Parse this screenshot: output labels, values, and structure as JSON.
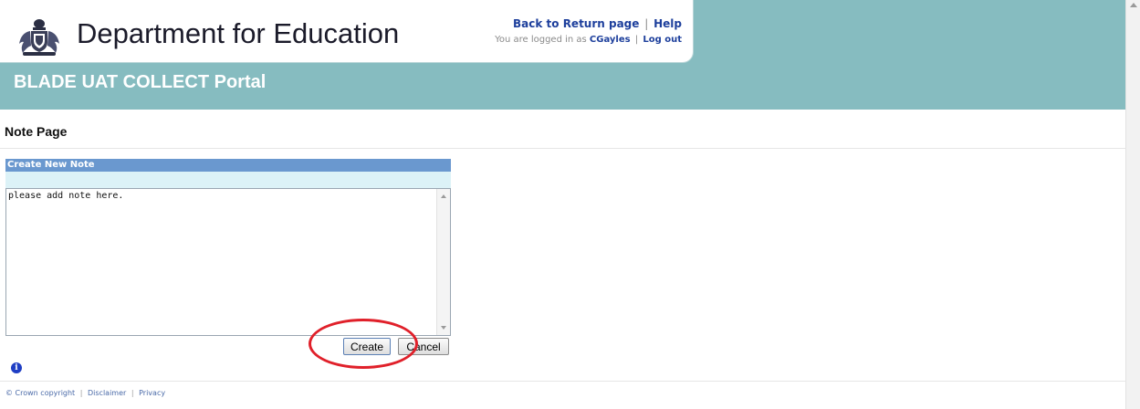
{
  "header": {
    "department": "Department for Education",
    "back_link": "Back to Return page",
    "separator": "|",
    "help_link": "Help",
    "logged_in_prefix": "You are logged in as",
    "username": "CGayles",
    "logout_link": "Log out",
    "portal_title": "BLADE UAT COLLECT Portal",
    "band_color": "#86bcc0"
  },
  "page": {
    "heading": "Note Page"
  },
  "note_panel": {
    "title": "Create New Note",
    "text_value": "please add note here.",
    "create_label": "Create",
    "cancel_label": "Cancel",
    "titlebar_color": "#6a98cf",
    "highlight_color": "#e0202a"
  },
  "icons": {
    "crest": "royal-coat-of-arms-icon",
    "info": "info-icon",
    "info_glyph": "i"
  },
  "footer": {
    "copyright": "© Crown copyright",
    "disclaimer": "Disclaimer",
    "privacy": "Privacy",
    "separator": "|"
  }
}
